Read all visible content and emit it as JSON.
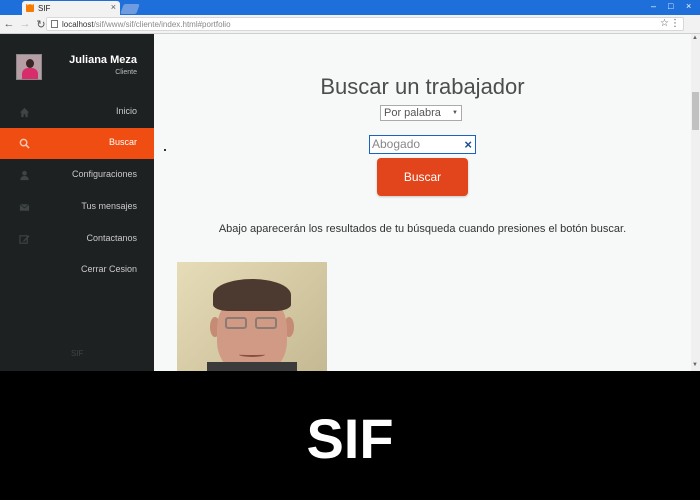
{
  "browser": {
    "tab_title": "SIF",
    "tab_favicon": "rss-feed-icon",
    "url_host": "localhost",
    "url_path": "/sif/www/sif/cliente/index.html#portfolio",
    "accent": "#1e6fd9"
  },
  "sidebar": {
    "user_name": "Juliana Meza",
    "user_role": "Cliente",
    "footer": "SIF",
    "items": [
      {
        "label": "Inicio",
        "icon": "home-icon",
        "active": false
      },
      {
        "label": "Buscar",
        "icon": "search-icon",
        "active": true
      },
      {
        "label": "Configuraciones",
        "icon": "user-icon",
        "active": false
      },
      {
        "label": "Tus mensajes",
        "icon": "envelope-icon",
        "active": false
      },
      {
        "label": "Contactanos",
        "icon": "edit-icon",
        "active": false
      },
      {
        "label": "Cerrar Cesion",
        "icon": "",
        "active": false
      }
    ],
    "active_color": "#f04d12"
  },
  "main": {
    "title": "Buscar un trabajador",
    "select_value": "Por palabra",
    "search_value": "Abogado",
    "button_label": "Buscar",
    "hint": "Abajo aparecerán los resultados de tu búsqueda cuando presiones el botón buscar.",
    "button_color": "#e2451b"
  },
  "caption": "SIF"
}
